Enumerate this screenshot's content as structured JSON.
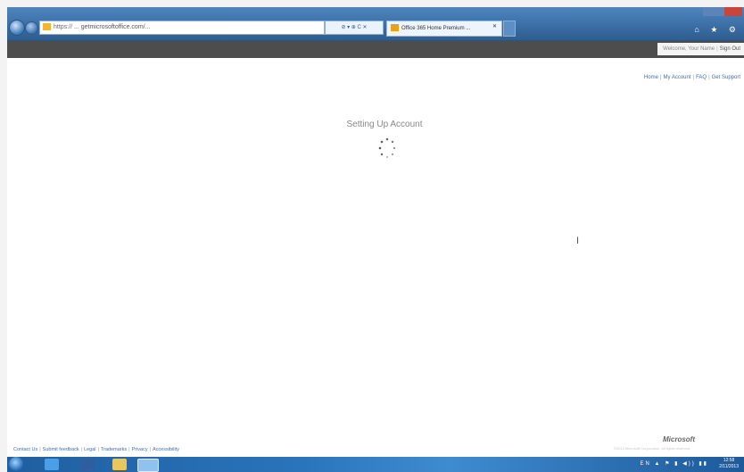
{
  "browser": {
    "address_prefix": "https://",
    "address_url": "... getmicrosoftoffice.com/...",
    "address_tools": "⊘ ▾ ⊕ C ✕",
    "tab_title": "Office 365 Home Premium ...",
    "tab_close": "✕",
    "tool_icons": "⌂ ★ ⚙"
  },
  "site_header": {
    "welcome_text": "Welcome, Your Name",
    "signout_label": "Sign Out"
  },
  "top_nav": {
    "home": "Home",
    "my_account": "My Account",
    "faq": "FAQ",
    "support": "Get Support"
  },
  "main": {
    "status_title": "Setting Up Account",
    "cursor_char": "I"
  },
  "footer": {
    "links": [
      "Contact Us",
      "Submit feedback",
      "Legal",
      "Trademarks",
      "Privacy",
      "Accessibility"
    ],
    "brand": "Microsoft",
    "copyright": "©2013 Microsoft Corporation. All rights reserved."
  },
  "taskbar": {
    "tray_icons": "EN ▲ ⚑ ▮ ◀)) ▮▮",
    "clock_time": "12:58",
    "clock_date": "2/11/2013"
  }
}
